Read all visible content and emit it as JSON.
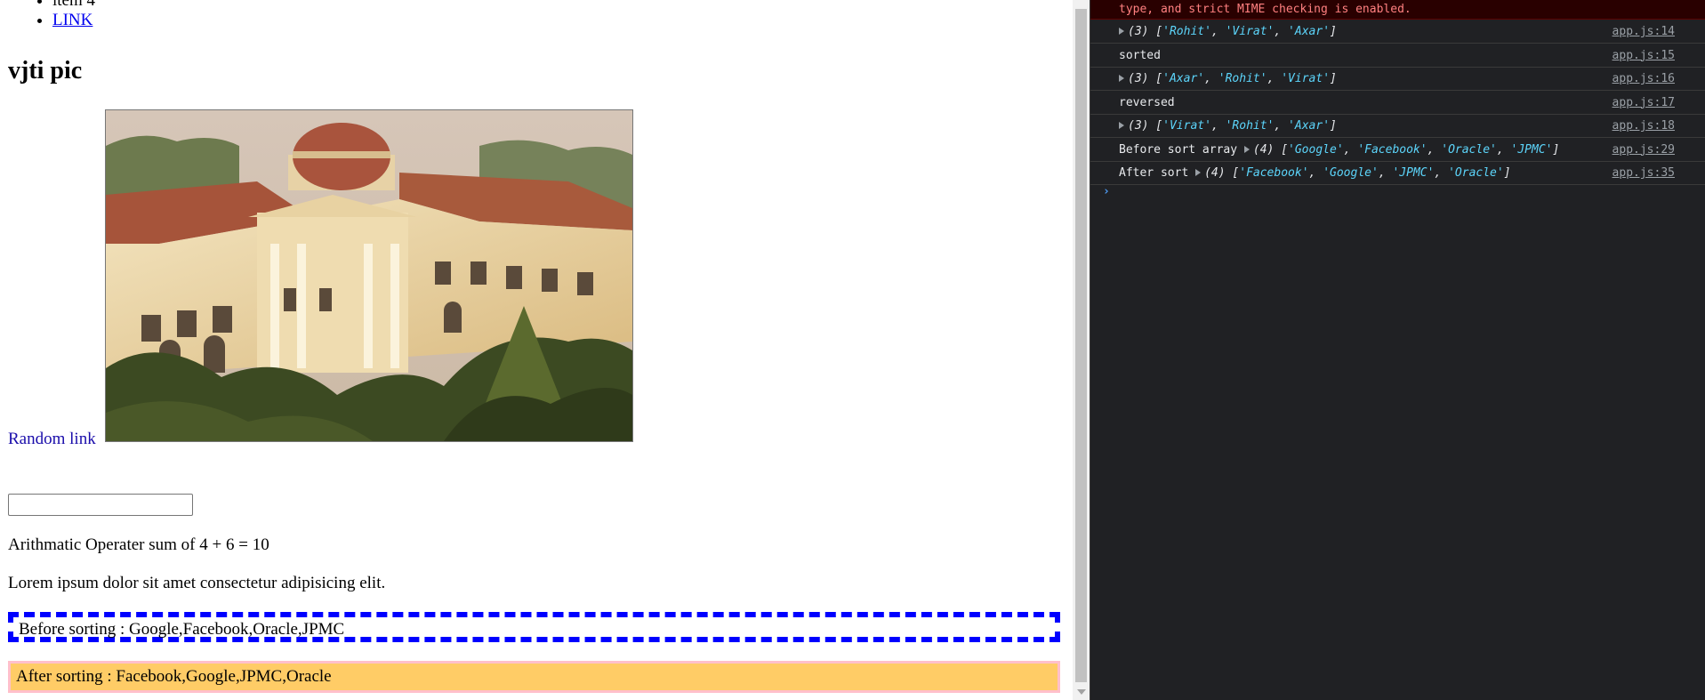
{
  "page": {
    "list": {
      "item4": "item 4",
      "link": "LINK"
    },
    "heading": "vjti pic",
    "random_link": "Random link",
    "input_value": "",
    "sum_text": "Arithmatic Operater sum of 4 + 6 = 10",
    "lorem": "Lorem ipsum dolor sit amet consectetur adipisicing elit.",
    "before_sorting": "Before sorting : Google,Facebook,Oracle,JPMC",
    "after_sorting": "After sorting : Facebook,Google,JPMC,Oracle"
  },
  "console": {
    "error_line": "type, and strict MIME checking is enabled.",
    "rows": [
      {
        "label": "",
        "count": "(3)",
        "items": [
          "Rohit",
          "Virat",
          "Axar"
        ],
        "source": "app.js:14"
      },
      {
        "label": "sorted",
        "source": "app.js:15"
      },
      {
        "label": "",
        "count": "(3)",
        "items": [
          "Axar",
          "Rohit",
          "Virat"
        ],
        "source": "app.js:16"
      },
      {
        "label": "reversed",
        "source": "app.js:17"
      },
      {
        "label": "",
        "count": "(3)",
        "items": [
          "Virat",
          "Rohit",
          "Axar"
        ],
        "source": "app.js:18"
      },
      {
        "label": "Before sort array",
        "count": "(4)",
        "items": [
          "Google",
          "Facebook",
          "Oracle",
          "JPMC"
        ],
        "source": "app.js:29"
      },
      {
        "label": "After sort",
        "count": "(4)",
        "items": [
          "Facebook",
          "Google",
          "JPMC",
          "Oracle"
        ],
        "source": "app.js:35"
      }
    ],
    "prompt": "›"
  }
}
